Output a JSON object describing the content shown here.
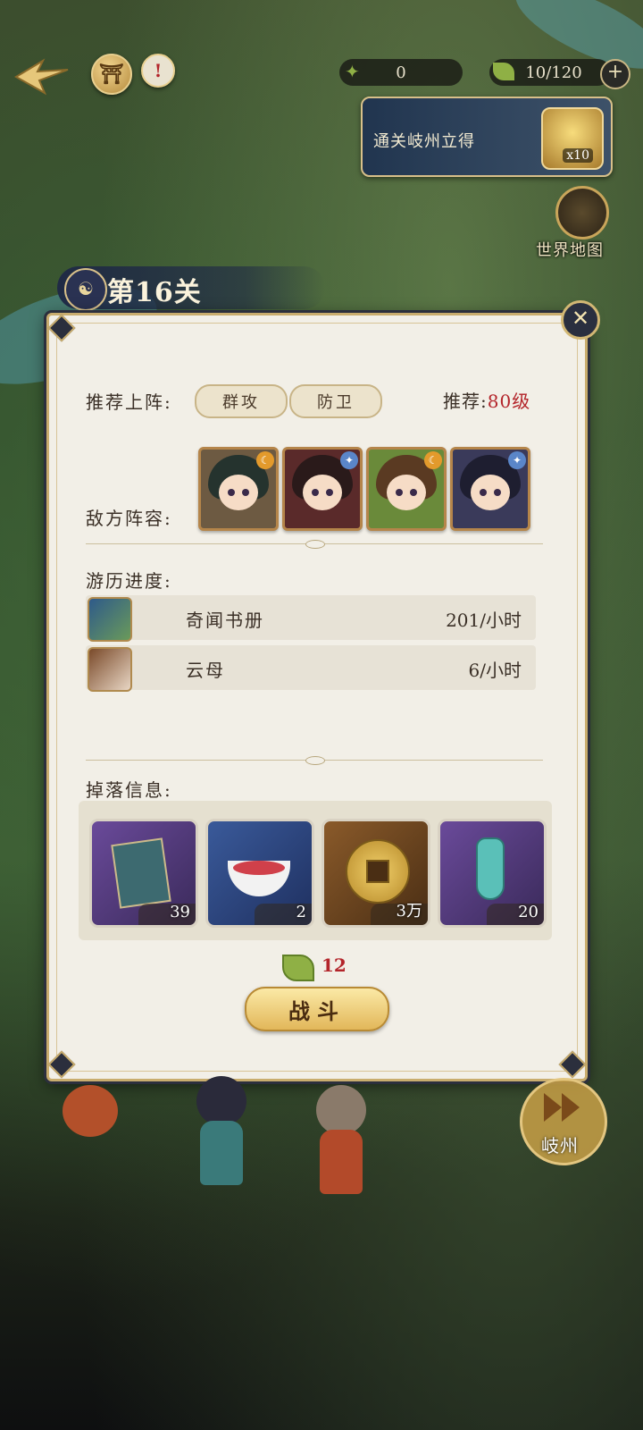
{
  "top_bar": {
    "resource_1_value": "0",
    "stamina_value": "10/120",
    "plus_label": "+",
    "alert_label": "!"
  },
  "reward_banner": {
    "text": "通关岐州立得",
    "count": "x10"
  },
  "world_map": {
    "label": "世界地图"
  },
  "level": {
    "title": "第16关"
  },
  "panel": {
    "recommend_label": "推荐上阵:",
    "recommend_tags": [
      "群攻",
      "防卫"
    ],
    "recommend_level_prefix": "推荐:",
    "recommend_level_value": "80级",
    "enemy_label": "敌方阵容:",
    "progress_label": "游历进度:",
    "progress_rows": [
      {
        "name": "奇闻书册",
        "rate": "201/小时"
      },
      {
        "name": "云母",
        "rate": "6/小时"
      }
    ],
    "drops_label": "掉落信息:",
    "drops": [
      {
        "name": "book",
        "count": "39",
        "icon": "book-icon"
      },
      {
        "name": "powder",
        "count": "2",
        "icon": "bowl-icon"
      },
      {
        "name": "coin",
        "count": "3万",
        "icon": "coin-icon"
      },
      {
        "name": "vase",
        "count": "20",
        "icon": "vase-icon"
      }
    ],
    "cost_value": "12",
    "fight_label": "战斗",
    "close_icon": "✕"
  },
  "next_area": {
    "label": "岐州"
  },
  "colors": {
    "accent_red": "#b3242a",
    "gold": "#d8c08a"
  }
}
